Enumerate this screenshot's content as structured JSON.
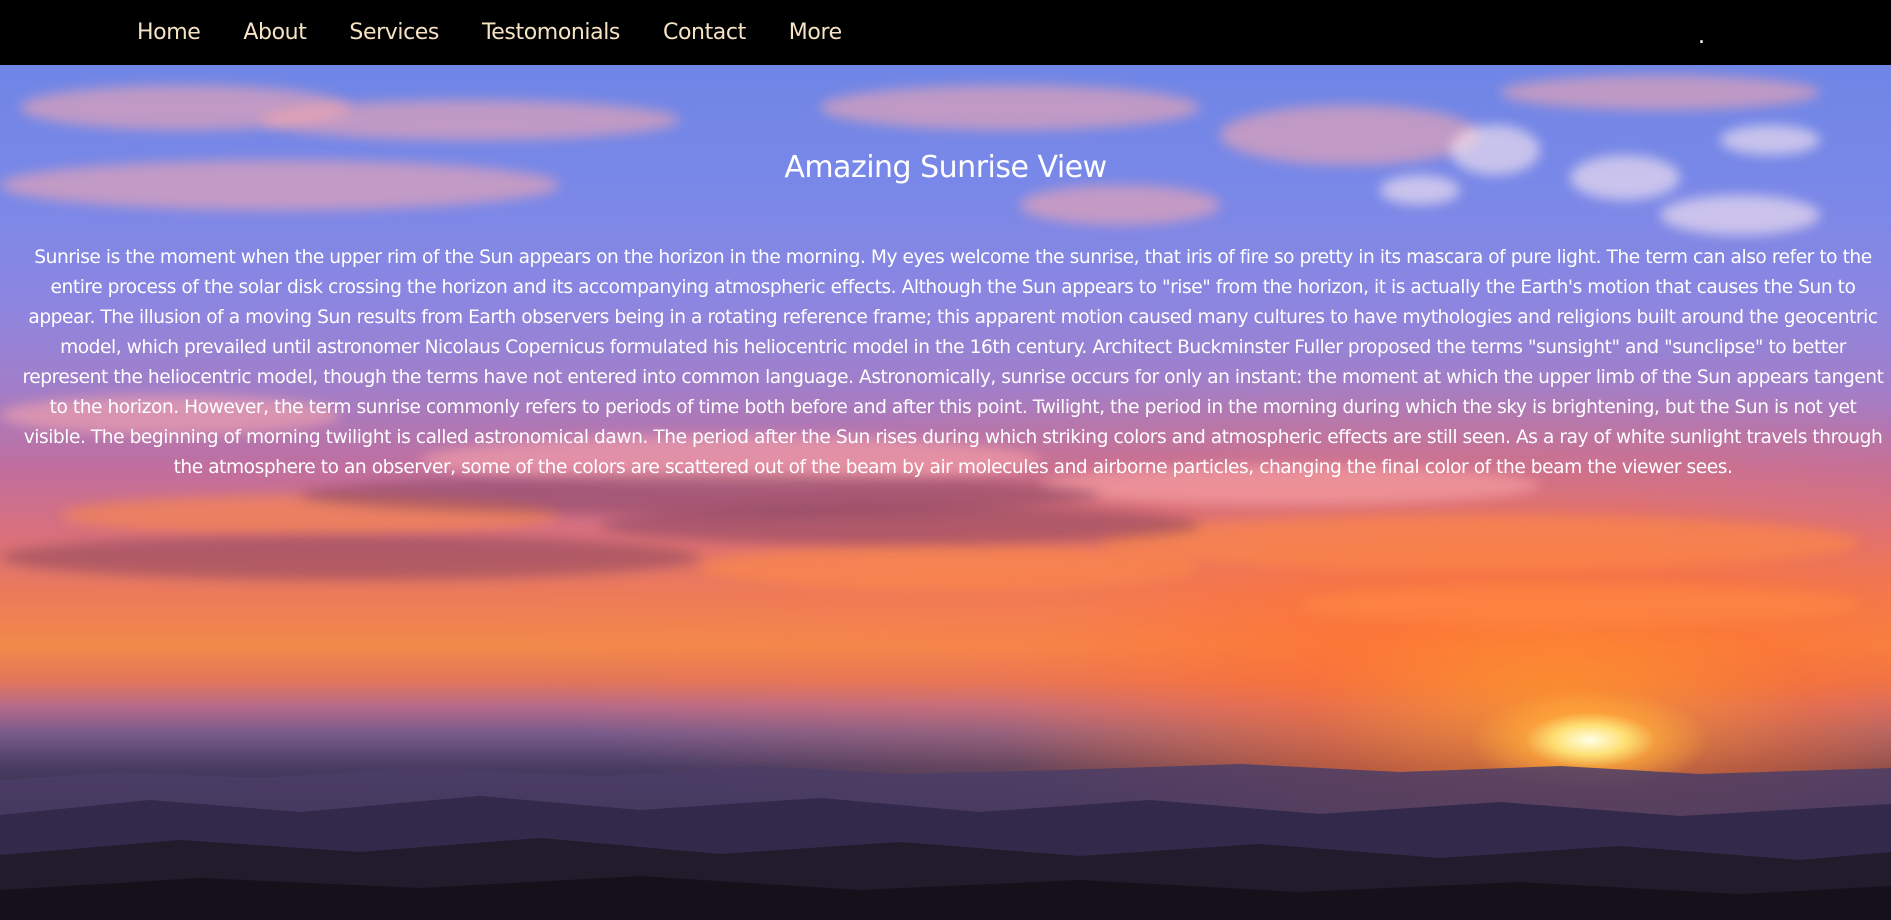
{
  "nav": {
    "items": [
      {
        "label": "Home"
      },
      {
        "label": "About"
      },
      {
        "label": "Services"
      },
      {
        "label": "Testomonials"
      },
      {
        "label": "Contact"
      },
      {
        "label": "More"
      }
    ],
    "trailing_text": "."
  },
  "hero": {
    "title": "Amazing Sunrise View",
    "paragraph": "Sunrise is the moment when the upper rim of the Sun appears on the horizon in the morning. My eyes welcome the sunrise, that iris of fire so pretty in its mascara of pure light. The term can also refer to the entire process of the solar disk crossing the horizon and its accompanying atmospheric effects. Although the Sun appears to \"rise\" from the horizon, it is actually the Earth's motion that causes the Sun to appear. The illusion of a moving Sun results from Earth observers being in a rotating reference frame; this apparent motion caused many cultures to have mythologies and religions built around the geocentric model, which prevailed until astronomer Nicolaus Copernicus formulated his heliocentric model in the 16th century. Architect Buckminster Fuller proposed the terms \"sunsight\" and \"sunclipse\" to better represent the heliocentric model, though the terms have not entered into common language. Astronomically, sunrise occurs for only an instant: the moment at which the upper limb of the Sun appears tangent to the horizon. However, the term sunrise commonly refers to periods of time both before and after this point. Twilight, the period in the morning during which the sky is brightening, but the Sun is not yet visible. The beginning of morning twilight is called astronomical dawn. The period after the Sun rises during which striking colors and atmospheric effects are still seen. As a ray of white sunlight travels through the atmosphere to an observer, some of the colors are scattered out of the beam by air molecules and airborne particles, changing the final color of the beam the viewer sees."
  },
  "colors": {
    "nav_background": "#000000",
    "nav_text": "#f6e3c3",
    "hero_text": "#ffffff"
  }
}
